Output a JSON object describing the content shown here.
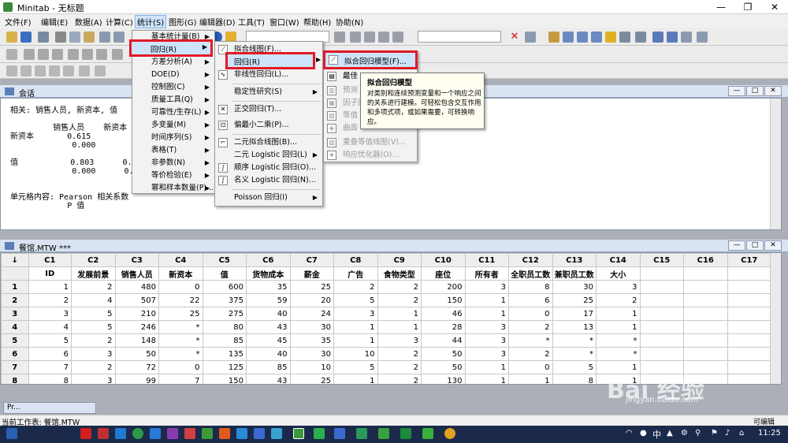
{
  "window": {
    "title": "Minitab - 无标题",
    "min": "—",
    "restore": "❐",
    "close": "✕"
  },
  "menubar": [
    "文件(F)",
    "编辑(E)",
    "数据(A)",
    "计算(C)",
    "统计(S)",
    "图形(G)",
    "编辑器(D)",
    "工具(T)",
    "窗口(W)",
    "帮助(H)",
    "协助(N)"
  ],
  "session": {
    "title": "会话",
    "lines": [
      "相关: 销售人员, 新资本, 值",
      "",
      "         销售人员    新资本",
      "新资本       0.615",
      "             0.000",
      "",
      "值           0.803      0.734",
      "             0.000      0.000",
      "",
      "",
      "单元格内容: Pearson 相关系数",
      "            P 值"
    ]
  },
  "worksheet": {
    "title": "餐馆.MTW ***",
    "corner": "↓",
    "cols": [
      "C1",
      "C2",
      "C3",
      "C4",
      "C5",
      "C6",
      "C7",
      "C8",
      "C9",
      "C10",
      "C11",
      "C12",
      "C13",
      "C14",
      "C15",
      "C16",
      "C17",
      "C18"
    ],
    "names": [
      "ID",
      "发展前景",
      "销售人员",
      "新资本",
      "值",
      "货物成本",
      "薪金",
      "广告",
      "食物类型",
      "座位",
      "所有者",
      "全职员工数",
      "兼职员工数",
      "大小",
      "",
      "",
      "",
      ""
    ],
    "rows": [
      [
        "1",
        "1",
        "2",
        "480",
        "0",
        "600",
        "35",
        "25",
        "2",
        "2",
        "200",
        "3",
        "8",
        "30",
        "3",
        "",
        "",
        "",
        ""
      ],
      [
        "2",
        "2",
        "4",
        "507",
        "22",
        "375",
        "59",
        "20",
        "5",
        "2",
        "150",
        "1",
        "6",
        "25",
        "2",
        "",
        "",
        "",
        ""
      ],
      [
        "3",
        "3",
        "5",
        "210",
        "25",
        "275",
        "40",
        "24",
        "3",
        "1",
        "46",
        "1",
        "0",
        "17",
        "1",
        "",
        "",
        "",
        ""
      ],
      [
        "4",
        "4",
        "5",
        "246",
        "*",
        "80",
        "43",
        "30",
        "1",
        "1",
        "28",
        "3",
        "2",
        "13",
        "1",
        "",
        "",
        "",
        ""
      ],
      [
        "5",
        "5",
        "2",
        "148",
        "*",
        "85",
        "45",
        "35",
        "1",
        "3",
        "44",
        "3",
        "*",
        "*",
        "*",
        "",
        "",
        "",
        ""
      ],
      [
        "6",
        "6",
        "3",
        "50",
        "*",
        "135",
        "40",
        "30",
        "10",
        "2",
        "50",
        "3",
        "2",
        "*",
        "*",
        "",
        "",
        "",
        ""
      ],
      [
        "7",
        "7",
        "2",
        "72",
        "0",
        "125",
        "85",
        "10",
        "5",
        "2",
        "50",
        "1",
        "0",
        "5",
        "1",
        "",
        "",
        "",
        ""
      ],
      [
        "8",
        "8",
        "3",
        "99",
        "7",
        "150",
        "43",
        "25",
        "1",
        "2",
        "130",
        "1",
        "1",
        "8",
        "1",
        "",
        "",
        "",
        ""
      ]
    ]
  },
  "stat_menu": [
    "基本统计量(B)",
    "回归(R)",
    "方差分析(A)",
    "DOE(D)",
    "控制图(C)",
    "质量工具(Q)",
    "可靠性/生存(L)",
    "多变量(M)",
    "时间序列(S)",
    "表格(T)",
    "非参数(N)",
    "等价检验(E)",
    "幂和样本数量(P)..."
  ],
  "reg_menu": [
    "拟合线图(F)...",
    "回归(R)",
    "非线性回归(L)...",
    "稳定性研究(S)",
    "正交回归(T)...",
    "偏最小二乘(P)...",
    "二元拟合线图(B)...",
    "二元 Logistic 回归(L)",
    "顺序 Logistic 回归(O)...",
    "名义 Logistic 回归(N)...",
    "Poisson 回归(I)"
  ],
  "sub_menu": [
    "拟合回归模型(F)...",
    "最佳",
    "预测",
    "因子图",
    "等值",
    "曲面",
    "重叠等值线图(V)...",
    "响应优化器(O)..."
  ],
  "tooltip": {
    "title": "拟合回归模型",
    "body": "对类别和连续预测变量和一个响应之间的关系进行建模。可轻松包含交互作用和多项式项，或如果需要，可转换响应。"
  },
  "minimized": {
    "label": "Pr..."
  },
  "status": {
    "left": "当前工作表: 餐馆.MTW",
    "right": "可编辑"
  },
  "taskbar": {
    "time": "11:25",
    "ime": "中"
  },
  "watermark": {
    "brand": "Bai  经验",
    "url": "jingyan.baidu.com"
  },
  "colors": {
    "highlight": "#cde4fb",
    "redbox": "#e01a26",
    "taskbar": "#1b2a4b"
  },
  "icons": [
    "save-icon",
    "open-icon",
    "cut-icon",
    "copy-icon",
    "paste-icon",
    "undo-icon",
    "redo-icon",
    "help-icon",
    "delete-icon",
    "search-icon"
  ]
}
